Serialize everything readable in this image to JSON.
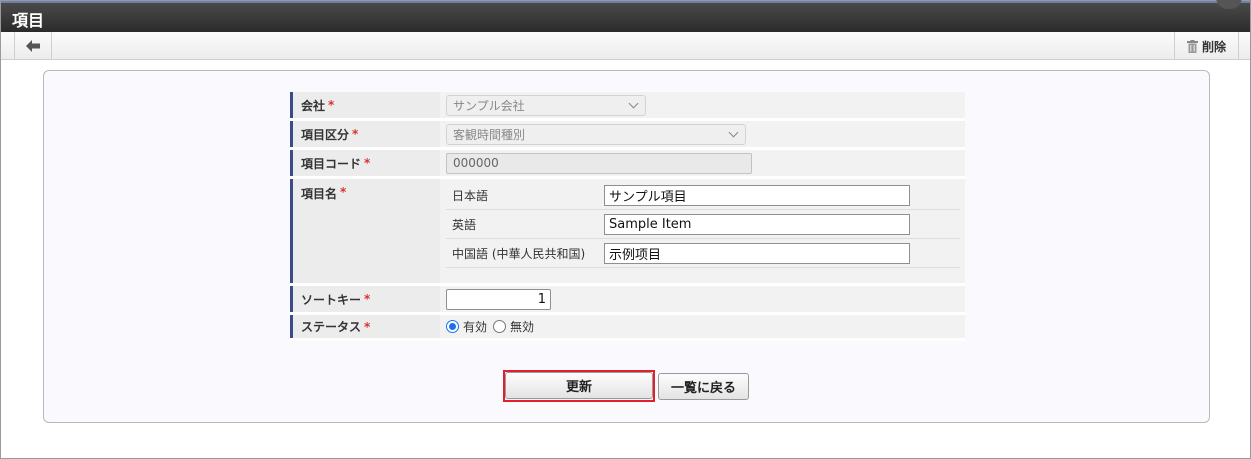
{
  "window": {
    "title": "項目"
  },
  "toolbar": {
    "back_icon": "arrow-left-icon",
    "delete_label": "削除",
    "delete_icon": "trash-icon"
  },
  "form": {
    "company": {
      "label": "会社",
      "value": "サンプル会社"
    },
    "category": {
      "label": "項目区分",
      "value": "客観時間種別"
    },
    "code": {
      "label": "項目コード",
      "value": "000000"
    },
    "name": {
      "label": "項目名",
      "languages": [
        {
          "label": "日本語",
          "value": "サンプル項目"
        },
        {
          "label": "英語",
          "value": "Sample Item"
        },
        {
          "label": "中国語 (中華人民共和国)",
          "value": "示例项目"
        }
      ]
    },
    "sort_key": {
      "label": "ソートキー",
      "value": "1"
    },
    "status": {
      "label": "ステータス",
      "options": [
        "有効",
        "無効"
      ],
      "selected": "有効"
    },
    "required_mark": "*"
  },
  "buttons": {
    "update": "更新",
    "back_to_list": "一覧に戻る"
  },
  "colors": {
    "required": "#d9322c",
    "label_accent": "#3a4a8c",
    "highlight": "#e0202a",
    "radio_on": "#1a73e8"
  }
}
